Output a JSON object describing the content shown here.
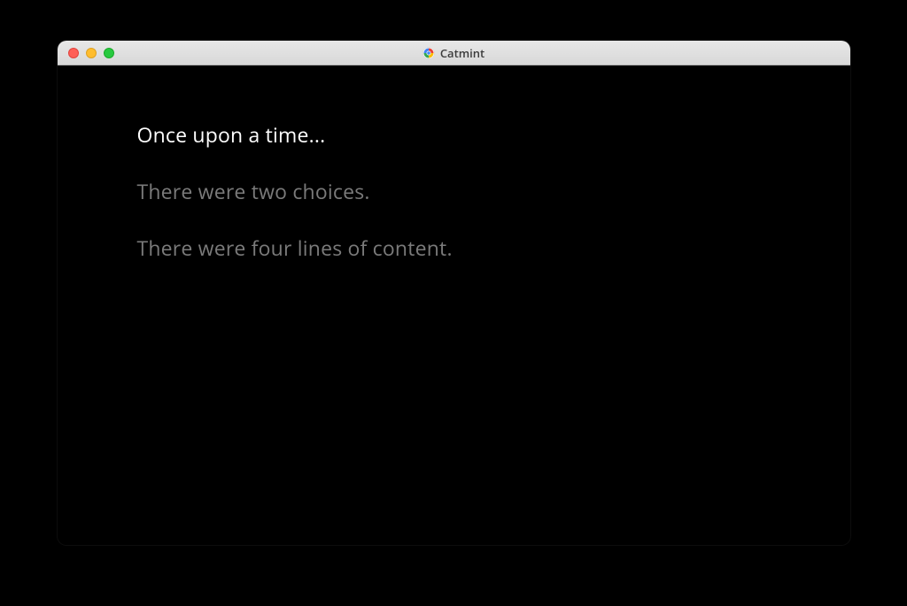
{
  "window": {
    "title": "Catmint"
  },
  "content": {
    "lines": [
      {
        "text": "Once upon a time...",
        "style": "primary"
      },
      {
        "text": "There were two choices.",
        "style": "secondary"
      },
      {
        "text": "There were four lines of content.",
        "style": "secondary"
      }
    ]
  }
}
